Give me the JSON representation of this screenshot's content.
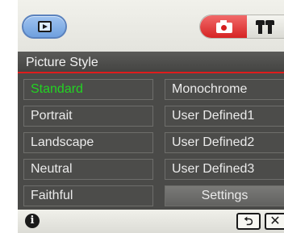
{
  "toolbar": {
    "playback_icon": "playback-icon",
    "camera_icon": "camera-icon",
    "tools_icon": "tools-icon"
  },
  "panel": {
    "title": "Picture Style",
    "accent_color": "#e01c1c",
    "selected_color": "#22d422"
  },
  "options": {
    "left": [
      {
        "label": "Standard",
        "selected": true
      },
      {
        "label": "Portrait",
        "selected": false
      },
      {
        "label": "Landscape",
        "selected": false
      },
      {
        "label": "Neutral",
        "selected": false
      },
      {
        "label": "Faithful",
        "selected": false
      }
    ],
    "right": [
      {
        "label": "Monochrome"
      },
      {
        "label": "User Defined1"
      },
      {
        "label": "User Defined2"
      },
      {
        "label": "User Defined3"
      },
      {
        "label": "Settings"
      }
    ]
  },
  "bottombar": {
    "info_icon": "info-icon",
    "info_glyph": "i",
    "return_glyph": "⮌",
    "close_glyph": "✕"
  }
}
